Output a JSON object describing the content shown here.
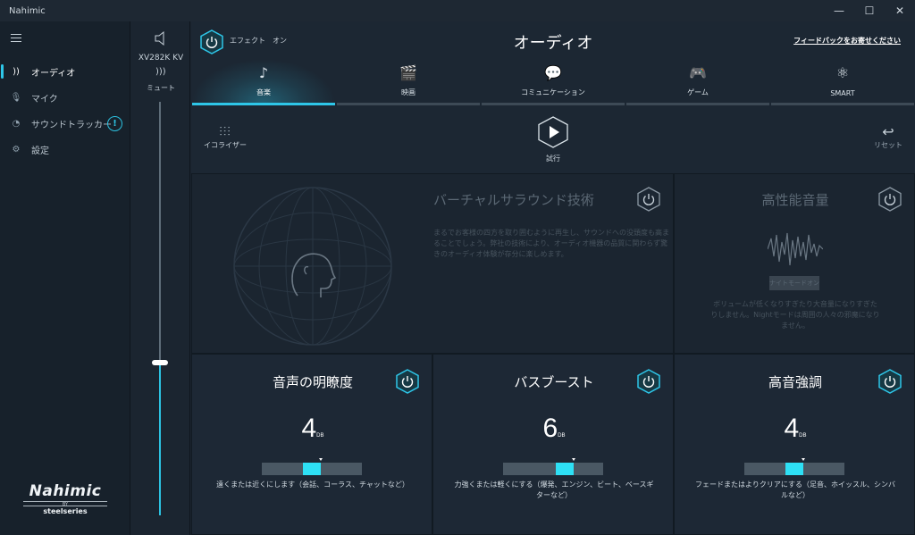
{
  "window": {
    "title": "Nahimic",
    "minimize": "—",
    "maximize": "☐",
    "close": "✕"
  },
  "sidebar": {
    "items": [
      {
        "label": "オーディオ",
        "icon": "audio-icon",
        "glyph": "))"
      },
      {
        "label": "マイク",
        "icon": "microphone-icon",
        "glyph": "🎙"
      },
      {
        "label": "サウンドトラッカー",
        "icon": "sound-tracker-icon",
        "glyph": "◔",
        "badge": "!"
      },
      {
        "label": "設定",
        "icon": "gear-icon",
        "glyph": "⚙"
      }
    ],
    "brand": {
      "logo": "Nahimic",
      "by": "BY",
      "partner": "steelseries"
    }
  },
  "device": {
    "name": "XV282K KV",
    "mute_label": "ミュート",
    "volume": 0.37
  },
  "header": {
    "effect_label": "エフェクト　オン",
    "title": "オーディオ",
    "feedback": "フィードバックをお寄せください"
  },
  "tabs": [
    {
      "label": "音楽",
      "glyph": "♪",
      "icon": "music-icon",
      "active": true
    },
    {
      "label": "映画",
      "glyph": "🎬",
      "icon": "clapperboard-icon",
      "active": false
    },
    {
      "label": "コミュニケーション",
      "glyph": "💬",
      "icon": "chat-icon",
      "active": false
    },
    {
      "label": "ゲーム",
      "glyph": "🎮",
      "icon": "gamepad-icon",
      "active": false
    },
    {
      "label": "SMART",
      "glyph": "⚛",
      "icon": "atom-icon",
      "active": false
    }
  ],
  "controls": {
    "equalizer": "イコライザー",
    "test": "試行",
    "reset": "リセット"
  },
  "surround": {
    "title": "バーチャルサラウンド技術",
    "description": "まるでお客様の四方を取り囲むように再生し、サウンドへの没頭度も高まることでしょう。弊社の技術により、オーディオ機器の品質に関わらず驚きのオーディオ体験が存分に楽しめます。"
  },
  "high_performance": {
    "title": "高性能音量",
    "night_button": "ナイトモードオン",
    "description": "ボリュームが低くなりすぎたり大音量になりすぎたりしません。Nightモードは周囲の人々の邪魔になりません。"
  },
  "cards": [
    {
      "title": "音声の明瞭度",
      "value": "4",
      "unit": "DB",
      "description": "遠くまたは近くにします（会話、コーラス、チャットなど）",
      "level": 0.5
    },
    {
      "title": "バスブースト",
      "value": "6",
      "unit": "DB",
      "description": "力強くまたは軽くにする（爆発、エンジン、ビート、ベースギターなど）",
      "level": 0.62
    },
    {
      "title": "高音強調",
      "value": "4",
      "unit": "DB",
      "description": "フェードまたはよりクリアにする（足音、ホイッスル、シンバルなど）",
      "level": 0.5
    }
  ],
  "colors": {
    "accent": "#2ec6e8",
    "slider": "#2ee0f5",
    "background": "#1c2733"
  }
}
